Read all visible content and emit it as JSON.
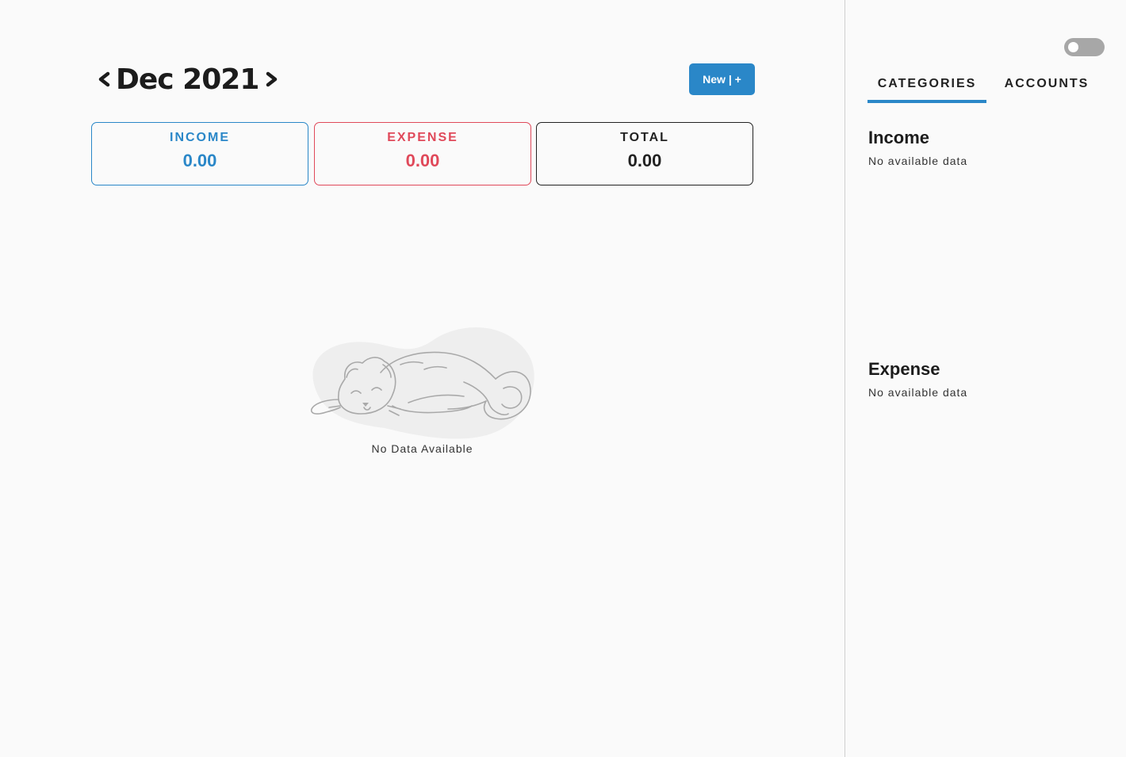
{
  "header": {
    "month_label": "Dec 2021",
    "prev_icon": "chevron-left-icon",
    "next_icon": "chevron-right-icon",
    "new_button_label": "New | +"
  },
  "summary": {
    "income": {
      "label": "INCOME",
      "value": "0.00",
      "color": "#2a87c8"
    },
    "expense": {
      "label": "EXPENSE",
      "value": "0.00",
      "color": "#e0495a"
    },
    "total": {
      "label": "TOTAL",
      "value": "0.00",
      "color": "#222222"
    }
  },
  "main": {
    "empty_illustration": "sleeping-cat-illustration",
    "empty_text": "No Data Available"
  },
  "sidebar": {
    "theme_toggle": {
      "state": "off"
    },
    "tabs": [
      {
        "label": "CATEGORIES",
        "active": true
      },
      {
        "label": "ACCOUNTS",
        "active": false
      }
    ],
    "income": {
      "title": "Income",
      "empty_text": "No available data"
    },
    "expense": {
      "title": "Expense",
      "empty_text": "No available data"
    }
  },
  "colors": {
    "accent": "#2a87c8",
    "expense": "#e0495a",
    "background": "#fafafa"
  }
}
